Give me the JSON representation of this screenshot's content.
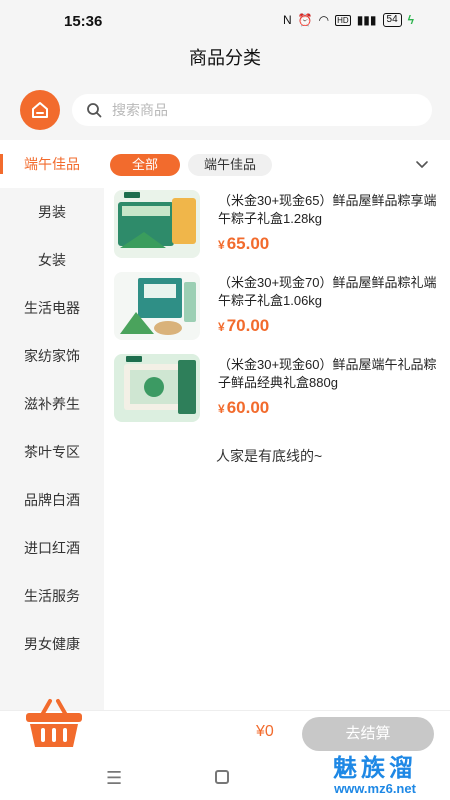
{
  "status": {
    "time": "15:36",
    "battery": "54"
  },
  "header": {
    "title": "商品分类"
  },
  "search": {
    "placeholder": "搜索商品"
  },
  "sidebar": {
    "items": [
      {
        "label": "端午佳品",
        "active": true
      },
      {
        "label": "男装"
      },
      {
        "label": "女装"
      },
      {
        "label": "生活电器"
      },
      {
        "label": "家纺家饰"
      },
      {
        "label": "滋补养生"
      },
      {
        "label": "茶叶专区"
      },
      {
        "label": "品牌白酒"
      },
      {
        "label": "进口红酒"
      },
      {
        "label": "生活服务"
      },
      {
        "label": "男女健康"
      }
    ]
  },
  "tabs": [
    {
      "label": "全部",
      "active": true
    },
    {
      "label": "端午佳品"
    }
  ],
  "products": [
    {
      "title": "（米金30+现金65）鲜品屋鲜品粽享端午粽子礼盒1.28kg",
      "currency": "¥",
      "price": "65.00"
    },
    {
      "title": "（米金30+现金70）鲜品屋鲜品粽礼端午粽子礼盒1.06kg",
      "currency": "¥",
      "price": "70.00"
    },
    {
      "title": "（米金30+现金60）鲜品屋端午礼品粽子鲜品经典礼盒880g",
      "currency": "¥",
      "price": "60.00"
    }
  ],
  "list_end": "人家是有底线的~",
  "cart": {
    "total": "¥0",
    "checkout_label": "去结算"
  },
  "watermark": {
    "big": "魅族溜",
    "small": "www.mz6.net"
  },
  "colors": {
    "accent": "#f26b2d",
    "sidebar_bg": "#f5f5f5",
    "disabled": "#c8c8c8"
  }
}
